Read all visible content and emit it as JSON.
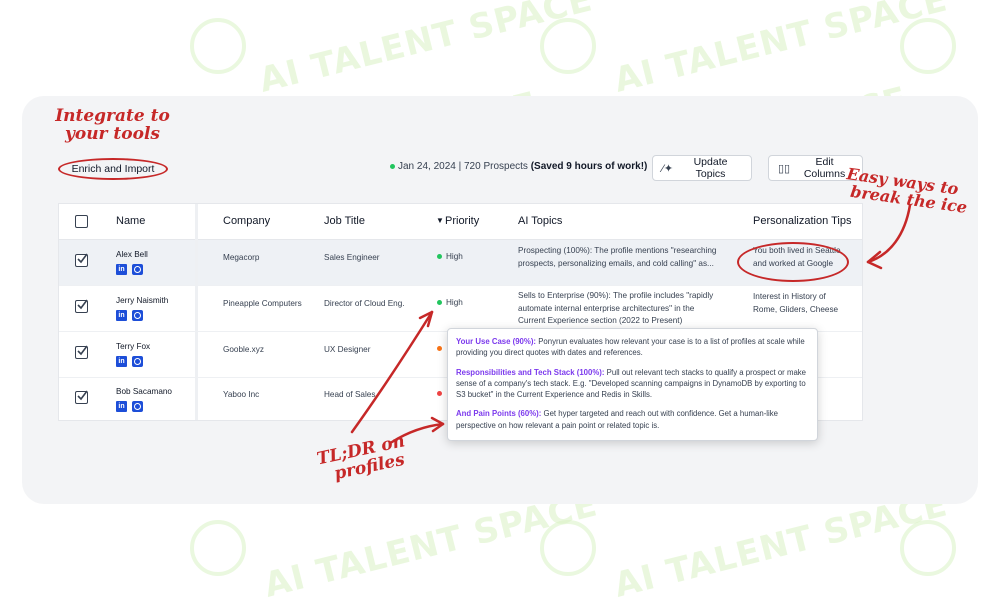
{
  "watermark": {
    "text": "AI TALENT SPACE"
  },
  "annotations": {
    "integrate_line1": "Integrate to",
    "integrate_line2": "your tools",
    "ice_line1": "Easy ways to",
    "ice_line2": "break the ice",
    "tldr_line1": "TL;DR on",
    "tldr_line2": "profiles"
  },
  "toolbar": {
    "enrich_label": "Enrich and Import",
    "summary_date": "Jan 24, 2024",
    "summary_count": "720 Prospects",
    "summary_saved": "(Saved 9 hours of work!)",
    "update_topics_label": "Update Topics",
    "edit_columns_label": "Edit Columns",
    "update_icon": "magic-wand-icon",
    "edit_icon": "columns-icon"
  },
  "table": {
    "headers": {
      "name": "Name",
      "company": "Company",
      "job_title": "Job Title",
      "priority": "Priority",
      "ai_topics": "AI Topics",
      "tips": "Personalization Tips"
    },
    "rows": [
      {
        "name": "Alex Bell",
        "company": "Megacorp",
        "job_title": "Sales Engineer",
        "priority": "High",
        "priority_color": "#22c55e",
        "topics_line1": "Prospecting (100%): The profile mentions \"researching",
        "topics_line2": "prospects, personalizing emails, and cold calling\" as...",
        "topics_line3": "",
        "tips_line1": "You both lived in Seattle",
        "tips_line2": "and worked at Google"
      },
      {
        "name": "Jerry Naismith",
        "company": "Pineapple Computers",
        "job_title": "Director of Cloud Eng.",
        "priority": "High",
        "priority_color": "#22c55e",
        "topics_line1": "Sells to Enterprise (90%): The profile includes \"rapidly",
        "topics_line2": "automate internal enterprise architectures\" in the",
        "topics_line3": "Current Experience section (2022 to Present)",
        "tips_line1": "Interest in History of",
        "tips_line2": "Rome, Gliders, Cheese"
      },
      {
        "name": "Terry Fox",
        "company": "Gooble.xyz",
        "job_title": "UX Designer",
        "priority": "",
        "priority_color": "#f97316",
        "topics_line1": "",
        "topics_line2": "",
        "topics_line3": "",
        "tips_line1": "",
        "tips_line2": ""
      },
      {
        "name": "Bob Sacamano",
        "company": "Yaboo Inc",
        "job_title": "Head of Sales",
        "priority": "",
        "priority_color": "#ef4444",
        "topics_line1": "",
        "topics_line2": "",
        "topics_line3": "",
        "tips_line1": "",
        "tips_line2": ""
      }
    ]
  },
  "tooltip": {
    "item1_key": "Your Use Case (90%):",
    "item1_text": "Ponyrun evaluates how relevant your case is to a list of profiles at scale while providing you direct quotes with dates and references.",
    "item2_key": "Responsibilities and Tech Stack (100%):",
    "item2_text": "Pull out relevant tech stacks to qualify a prospect or make sense of a company's tech stack. E.g. \"Developed scanning campaigns in DynamoDB by exporting to S3 bucket\" in the Current Experience and Redis in Skills.",
    "item3_key": "And Pain Points (60%):",
    "item3_text": "Get hyper targeted and reach out with confidence. Get a human-like perspective on how relevant a pain point or related topic is."
  },
  "colors": {
    "accent_red": "#c62828",
    "link_blue": "#1d4ed8",
    "highlight_purple": "#7c3aed",
    "high_green": "#22c55e"
  }
}
